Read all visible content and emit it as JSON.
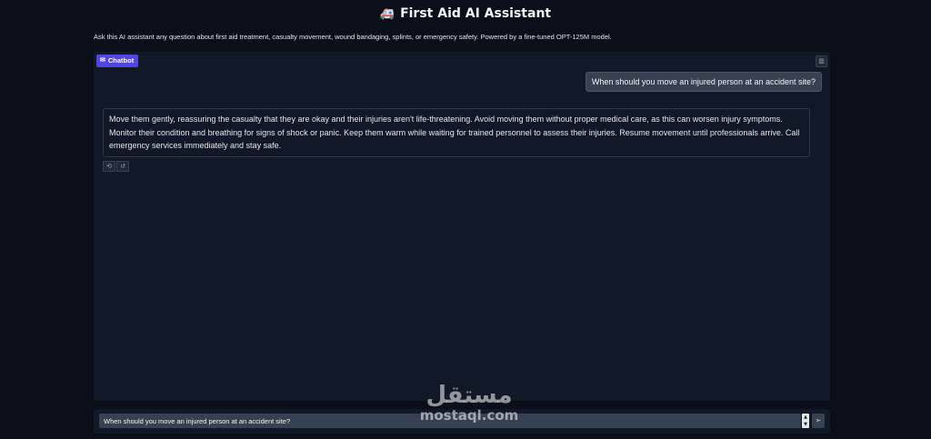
{
  "header": {
    "icon": "ambulance-icon",
    "icon_glyph": "🚑",
    "title": "First Aid AI Assistant",
    "subtitle": "Ask this AI assistant any question about first aid treatment, casualty movement, wound bandaging, splints, or emergency safety. Powered by a fine-tuned OPT-125M model."
  },
  "chat": {
    "badge_label": "Chatbot",
    "badge_icon": "chat-icon",
    "clear_icon": "trash-icon",
    "messages": [
      {
        "role": "user",
        "text": "When should you move an injured person at an accident site?"
      },
      {
        "role": "assistant",
        "text": "Move them gently, reassuring the casualty that they are okay and their injuries aren't life-threatening. Avoid moving them without proper medical care, as this can worsen injury symptoms. Monitor their condition and breathing for signs of shock or panic. Keep them warm while waiting for trained personnel to assess their injuries. Resume movement until professionals arrive. Call emergency services immediately and stay safe."
      }
    ],
    "actions": [
      "retry-icon",
      "undo-icon"
    ]
  },
  "input": {
    "value": "When should you move an injured person at an accident site?",
    "send_icon": "send-icon"
  },
  "watermark": {
    "arabic": "مستقل",
    "latin": "mostaql.com"
  }
}
